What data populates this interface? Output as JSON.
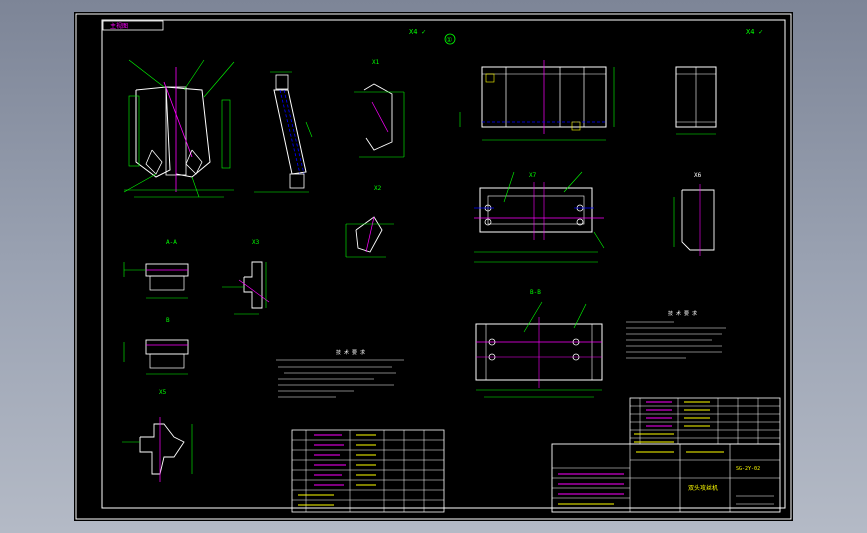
{
  "drawing": {
    "title_box": "主视图",
    "circled_number": "①",
    "roughness_mark_left": "X4 ✓",
    "roughness_mark_right": "X4 ✓",
    "section_labels": [
      "A-A",
      "X1",
      "X2",
      "X3",
      "B",
      "X5",
      "X6",
      "B-B",
      "X7"
    ],
    "tech_requirements_title": "技 术 要 求",
    "tech_requirements_title_right": "技 术 要 求",
    "title_block_name": "双头攻丝机",
    "title_block_code": "SG-2Y-02"
  },
  "colors": {
    "background": "#000000",
    "frame": "#ffffff",
    "geometry": "#ffffff",
    "dimension": "#00ff00",
    "centerline": "#ff00ff",
    "hidden": "#0000ff",
    "text": "#ffff00",
    "leader": "#00ffff"
  }
}
